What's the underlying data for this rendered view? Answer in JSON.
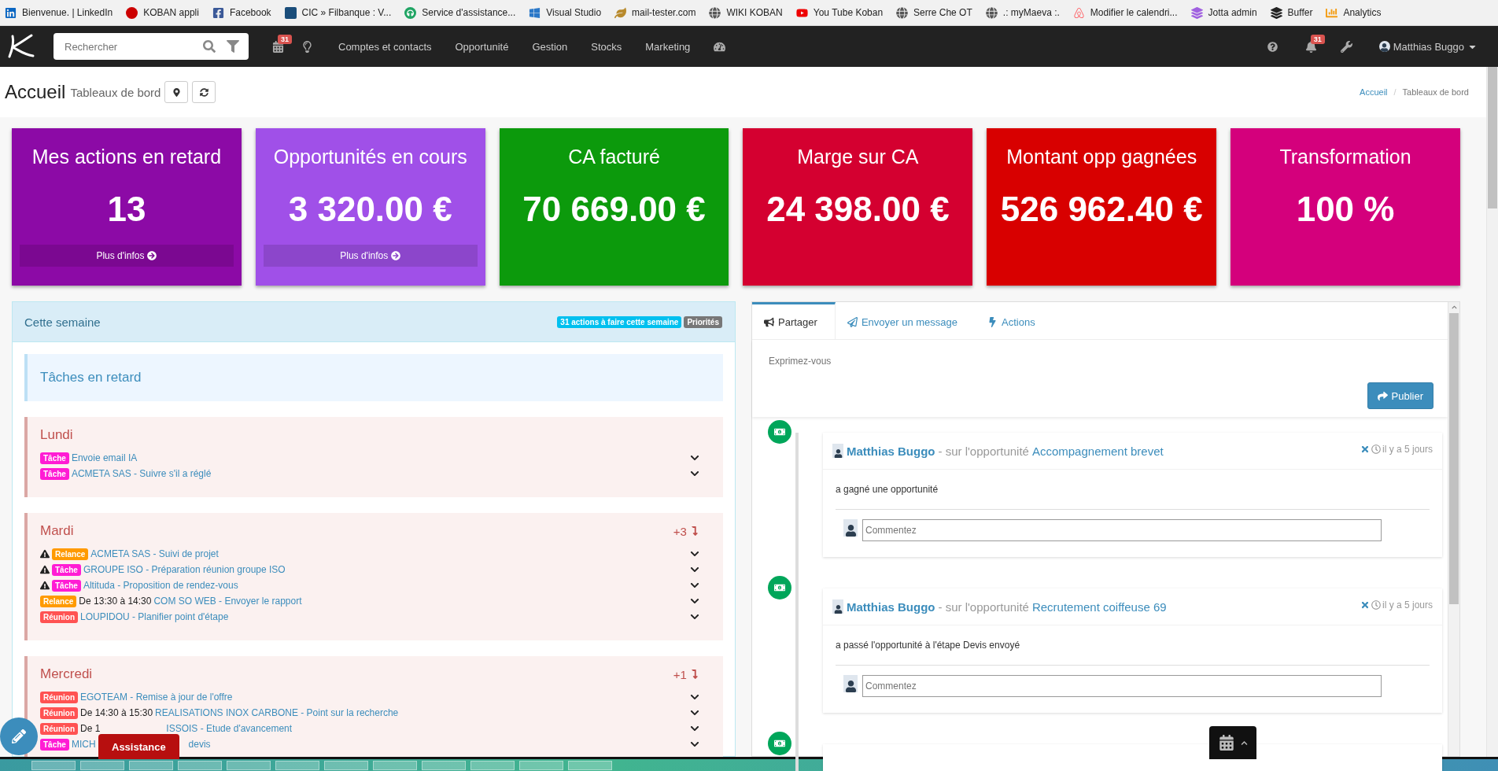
{
  "bookmarks": [
    {
      "label": "Bienvenue. | LinkedIn"
    },
    {
      "label": "KOBAN appli"
    },
    {
      "label": "Facebook"
    },
    {
      "label": "CIC » Filbanque : V..."
    },
    {
      "label": "Service d'assistance..."
    },
    {
      "label": "Visual Studio"
    },
    {
      "label": "mail-tester.com"
    },
    {
      "label": "WIKI KOBAN"
    },
    {
      "label": "You Tube Koban"
    },
    {
      "label": "Serre Che OT"
    },
    {
      "label": ".: myMaeva :."
    },
    {
      "label": "Modifier le calendri..."
    },
    {
      "label": "Jotta admin"
    },
    {
      "label": "Buffer"
    },
    {
      "label": "Analytics"
    }
  ],
  "navbar": {
    "search": {
      "placeholder": "Rechercher"
    },
    "calendar_badge": "31",
    "menu": [
      {
        "label": "Comptes et contacts"
      },
      {
        "label": "Opportunité"
      },
      {
        "label": "Gestion"
      },
      {
        "label": "Stocks"
      },
      {
        "label": "Marketing"
      }
    ],
    "notifications_badge": "31",
    "user": "Matthias Buggo"
  },
  "page": {
    "title": "Accueil",
    "subtitle": "Tableaux de bord",
    "breadcrumb_separator": "/",
    "breadcrumb": [
      {
        "label": "Accueil",
        "selected": false
      },
      {
        "label": "Tableaux de bord",
        "selected": true
      }
    ]
  },
  "kpis": [
    {
      "title": "Mes actions en retard",
      "value": "13",
      "more": "Plus d'infos",
      "color": "#8c0aa6"
    },
    {
      "title": "Opportunités en cours",
      "value": "3 320.00 €",
      "more": "Plus d'infos",
      "color": "#a050e8"
    },
    {
      "title": "CA facturé",
      "value": "70 669.00 €",
      "color": "#0c9a0c"
    },
    {
      "title": "Marge sur CA",
      "value": "24 398.00 €",
      "color": "#d40030"
    },
    {
      "title": "Montant opp gagnées",
      "value": "526 962.40 €",
      "color": "#d80000"
    },
    {
      "title": "Transformation",
      "value": "100 %",
      "color": "#d4007c"
    }
  ],
  "week": {
    "title": "Cette semaine",
    "badges": [
      {
        "label": "31 actions à faire cette semaine",
        "kind": "info"
      },
      {
        "label": "Priorités",
        "kind": "muted"
      }
    ],
    "overdue": {
      "title": "Tâches en retard"
    },
    "days": [
      {
        "name": "Lundi",
        "items": [
          {
            "kind": "task",
            "badge": "Tâche",
            "warning": false,
            "link": "Envoie email IA"
          },
          {
            "kind": "task",
            "badge": "Tâche",
            "warning": false,
            "link": "ACMETA SAS - Suivre s'il a réglé"
          }
        ]
      },
      {
        "name": "Mardi",
        "more": "+3",
        "items": [
          {
            "kind": "reminder",
            "badge": "Relance",
            "warning": true,
            "link": "ACMETA SAS - Suivi de projet"
          },
          {
            "kind": "task",
            "badge": "Tâche",
            "warning": true,
            "link": "GROUPE ISO - Préparation réunion groupe ISO"
          },
          {
            "kind": "task",
            "badge": "Tâche",
            "warning": true,
            "link": "Altituda - Proposition de rendez-vous"
          },
          {
            "kind": "reminder",
            "badge": "Relance",
            "warning": false,
            "time": "De 13:30 à 14:30",
            "link": "COM SO WEB - Envoyer le rapport"
          },
          {
            "kind": "meeting",
            "badge": "Réunion",
            "warning": false,
            "link": "LOUPIDOU - Planifier point d'étape"
          }
        ]
      },
      {
        "name": "Mercredi",
        "more": "+1",
        "items": [
          {
            "kind": "meeting",
            "badge": "Réunion",
            "warning": false,
            "link": "EGOTEAM - Remise à jour de l'offre"
          },
          {
            "kind": "meeting",
            "badge": "Réunion",
            "warning": false,
            "time": "De 14:30 à 15:30",
            "link": "REALISATIONS INOX CARBONE - Point sur la recherche"
          },
          {
            "kind": "meeting",
            "badge": "Réunion",
            "warning": false,
            "time": "De 1",
            "link": "ISSOIS - Etude d'avancement",
            "covered": true
          },
          {
            "kind": "task",
            "badge": "Tâche",
            "warning": false,
            "link": "MICH",
            "link_tail": "devis",
            "covered": true
          }
        ]
      }
    ]
  },
  "share": {
    "tabs": [
      {
        "label": "Partager",
        "selected": true
      },
      {
        "label": "Envoyer un message",
        "selected": false
      },
      {
        "label": "Actions",
        "selected": false
      }
    ],
    "composer": {
      "placeholder": "Exprimez-vous"
    },
    "publish": "Publier",
    "feed": [
      {
        "author": "Matthias Buggo",
        "context": "- sur l'opportunité",
        "target": "Accompagnement brevet",
        "time": "il y a 5 jours",
        "body": "a gagné une opportunité",
        "comment_placeholder": "Commentez"
      },
      {
        "author": "Matthias Buggo",
        "context": "- sur l'opportunité",
        "target": "Recrutement coiffeuse 69",
        "time": "il y a 5 jours",
        "body": "a passé l'opportunité à l'étape Devis envoyé",
        "comment_placeholder": "Commentez"
      }
    ]
  },
  "assistance": "Assistance"
}
